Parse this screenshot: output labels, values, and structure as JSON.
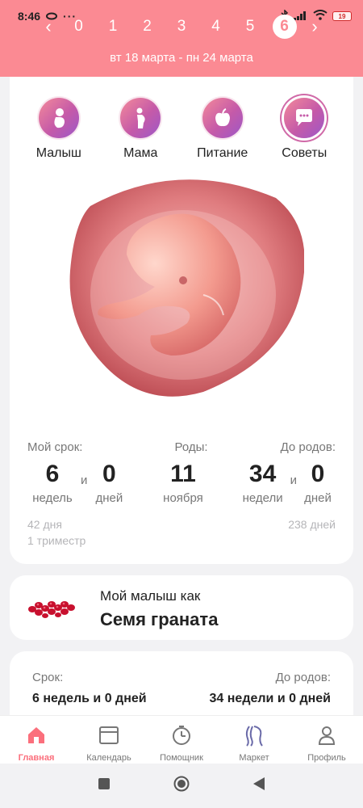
{
  "status_bar": {
    "time": "8:46",
    "battery": "19"
  },
  "week_selector": {
    "weeks": [
      "0",
      "1",
      "2",
      "3",
      "4",
      "5",
      "6"
    ],
    "active_week": "6",
    "date_range": "вт 18 марта - пн 24 марта"
  },
  "categories": [
    {
      "label": "Малыш",
      "icon": "baby-icon"
    },
    {
      "label": "Мама",
      "icon": "pregnant-woman-icon"
    },
    {
      "label": "Питание",
      "icon": "apple-icon"
    },
    {
      "label": "Советы",
      "icon": "chat-bubble-icon"
    }
  ],
  "stats": {
    "term_label": "Мой срок:",
    "term_weeks": "6",
    "term_weeks_unit": "недель",
    "conj": "и",
    "term_days": "0",
    "term_days_unit": "дней",
    "birth_label": "Роды:",
    "birth_day": "11",
    "birth_month": "ноября",
    "until_label": "До родов:",
    "until_weeks": "34",
    "until_weeks_unit": "недели",
    "until_days": "0",
    "until_days_unit": "дней",
    "total_days": "42 дня",
    "trimester": "1 триместр",
    "days_left": "238 дней"
  },
  "baby_size": {
    "prefix": "Мой малыш как",
    "name": "Семя граната"
  },
  "term_card": {
    "term_label": "Срок:",
    "term_value": "6 недель и 0 дней",
    "until_label": "До родов:",
    "until_value": "34 недели и 0 дней"
  },
  "bottom_nav": [
    {
      "label": "Главная",
      "icon": "home-icon"
    },
    {
      "label": "Календарь",
      "icon": "calendar-icon"
    },
    {
      "label": "Помощник",
      "icon": "timer-icon"
    },
    {
      "label": "Маркет",
      "icon": "market-icon"
    },
    {
      "label": "Профиль",
      "icon": "profile-icon"
    }
  ],
  "colors": {
    "accent": "#fb8a93",
    "active_nav": "#fb6f7c"
  }
}
